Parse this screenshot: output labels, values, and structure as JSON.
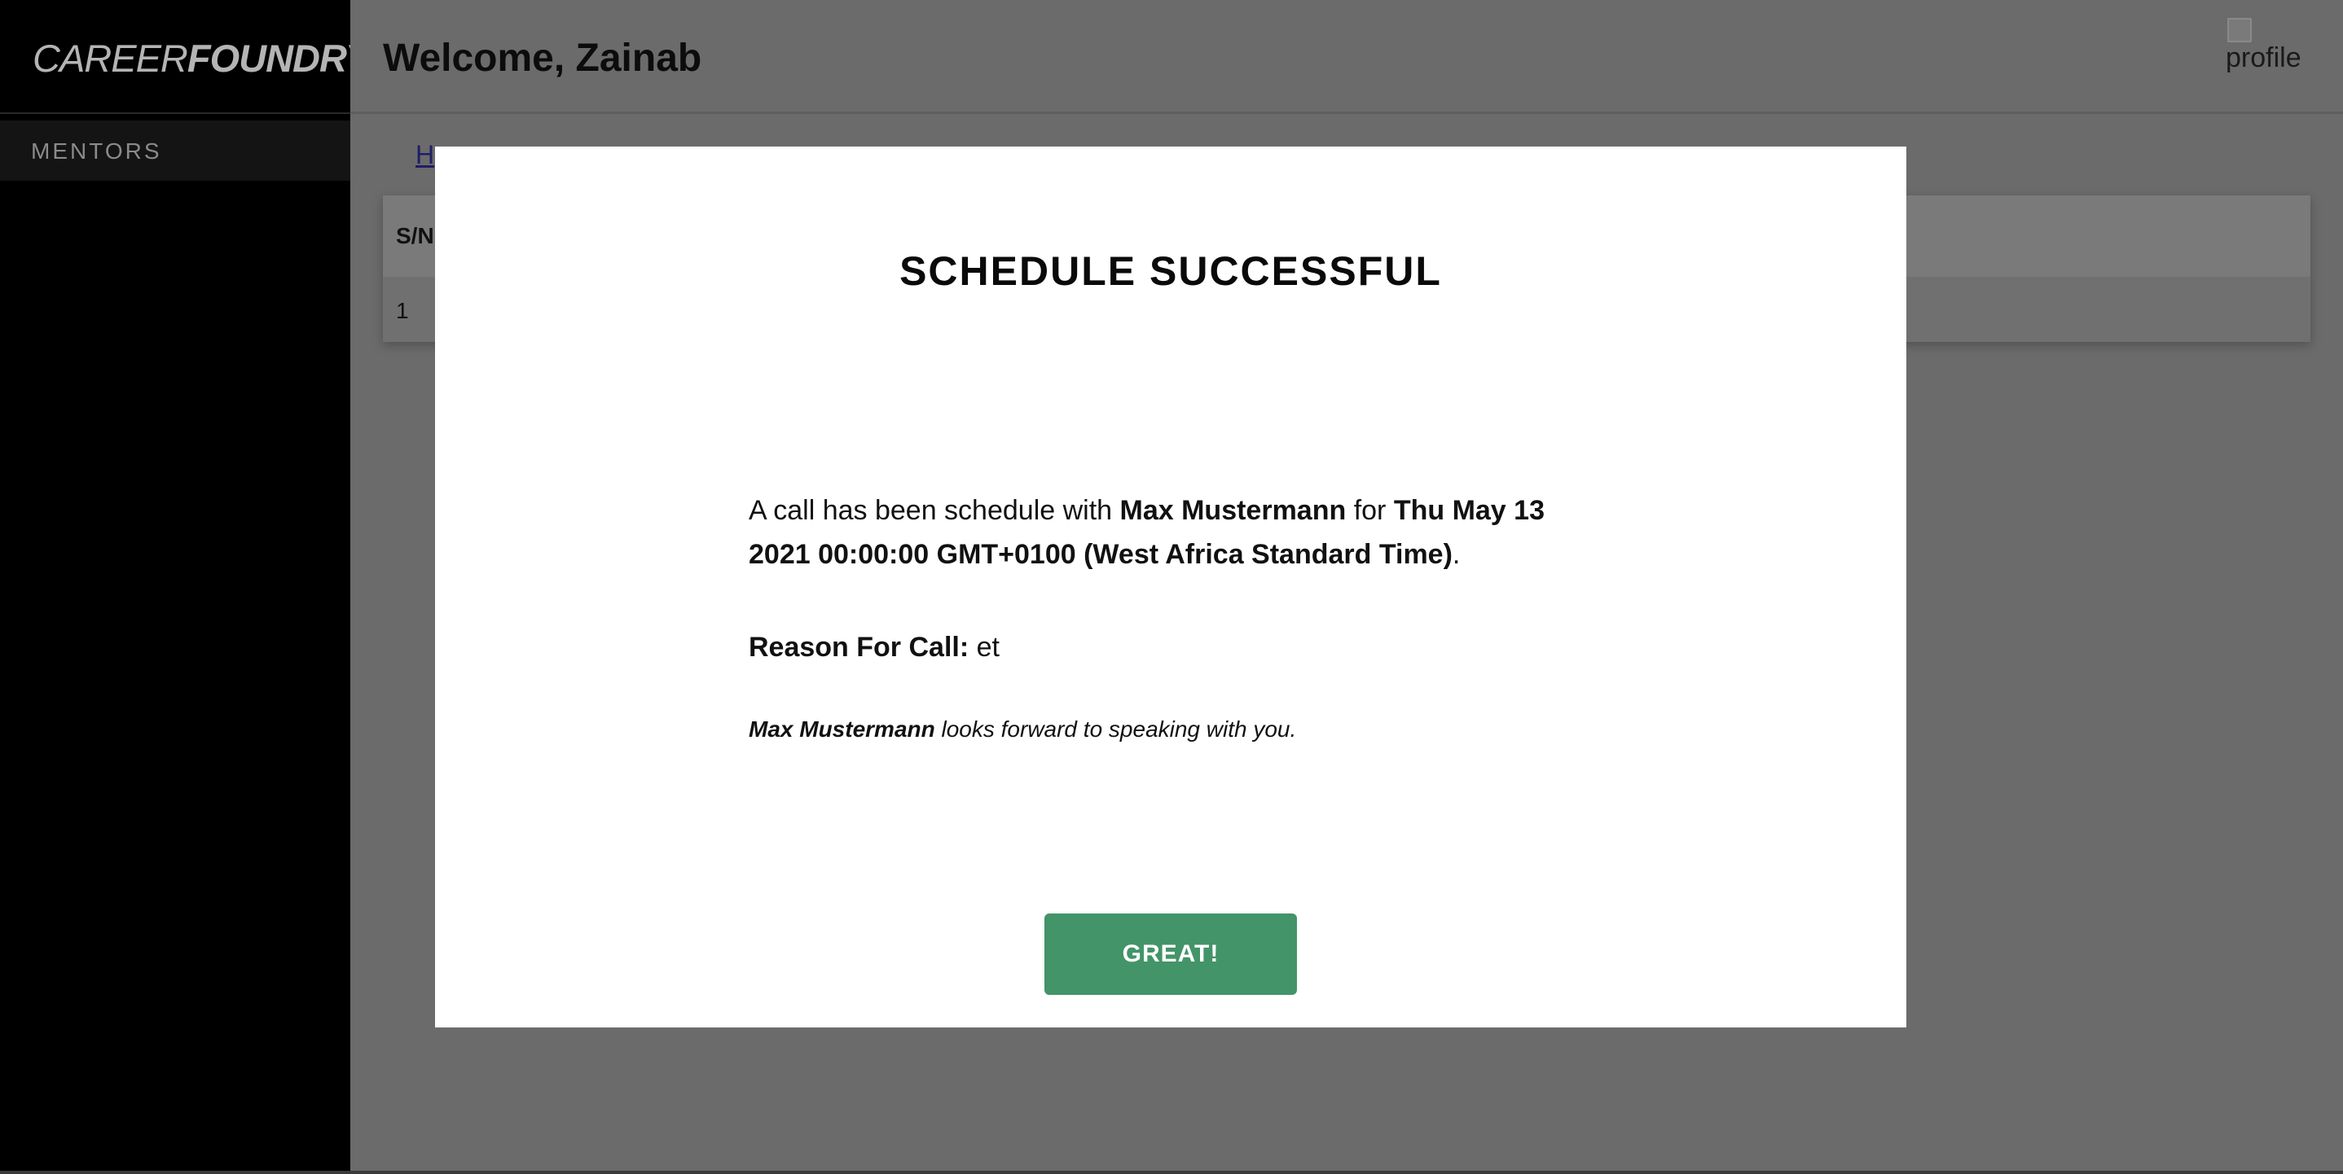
{
  "sidebar": {
    "logo_part1": "CAREER",
    "logo_part2": "FOUNDRY",
    "items": [
      {
        "label": "MENTORS"
      }
    ]
  },
  "header": {
    "welcome": "Welcome, Zainab",
    "profile_alt": "profile"
  },
  "main": {
    "breadcrumb": "H",
    "table": {
      "headers": [
        "S/N"
      ],
      "rows": [
        [
          "1"
        ]
      ]
    }
  },
  "modal": {
    "title": "SCHEDULE SUCCESSFUL",
    "intro": "A call has been schedule with ",
    "mentor": "Max Mustermann",
    "for_word": " for ",
    "datetime": "Thu May 13 2021 00:00:00 GMT+0100 (West Africa Standard Time)",
    "period": ".",
    "reason_label": "Reason For Call:",
    "reason_value": " et",
    "note_name": "Max Mustermann",
    "note_rest": " looks forward to speaking with you.",
    "button": "GREAT!"
  },
  "colors": {
    "overlay": "#6b6b6b",
    "sidebar": "#000000",
    "button": "#439468"
  }
}
